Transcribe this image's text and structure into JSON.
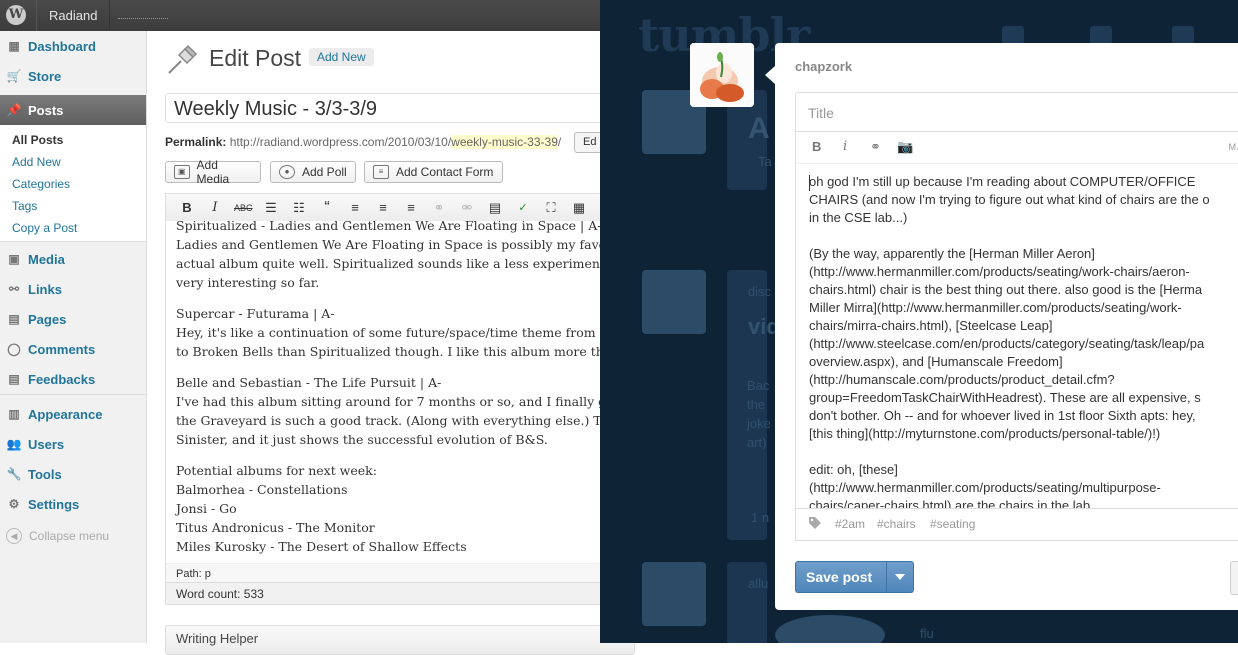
{
  "wp": {
    "site_name": "Radiand",
    "menu": [
      {
        "label": "Dashboard"
      },
      {
        "label": "Store"
      },
      {
        "label": "Posts"
      },
      {
        "label": "Media"
      },
      {
        "label": "Links"
      },
      {
        "label": "Pages"
      },
      {
        "label": "Comments"
      },
      {
        "label": "Feedbacks"
      },
      {
        "label": "Appearance"
      },
      {
        "label": "Users"
      },
      {
        "label": "Tools"
      },
      {
        "label": "Settings"
      }
    ],
    "posts_submenu": [
      "All Posts",
      "Add New",
      "Categories",
      "Tags",
      "Copy a Post"
    ],
    "collapse_label": "Collapse menu",
    "page_title": "Edit Post",
    "add_new_label": "Add New",
    "post_title": "Weekly Music - 3/3-3/9",
    "permalink_label": "Permalink:",
    "permalink_base": "http://radiand.wordpress.com/2010/03/10/",
    "permalink_slug": "weekly-music-33-39",
    "permalink_tail": "/",
    "edit_slug_label": "Ed",
    "media_buttons": [
      "Add Media",
      "Add Poll",
      "Add Contact Form"
    ],
    "editor_lines": [
      "Spiritualized - Ladies and Gentlemen We Are Floating in Space | A-",
      "Ladies and Gentlemen We Are Floating in Space is possibly my favori",
      "actual album quite well. Spiritualized sounds like a less experimental",
      "very interesting so far.",
      "Supercar - Futurama | A-",
      "Hey, it's like a continuation of some future/space/time theme from La",
      "to Broken Bells than Spiritualized though. I like this album more than",
      "Belle and Sebastian - The Life Pursuit | A-",
      "I've had this album sitting around for 7 months or so, and I finally ga",
      "the Graveyard is such a good track. (Along with everything else.) The",
      "Sinister, and it just shows the successful evolution of B&S.",
      "Potential albums for next week:",
      "Balmorhea - Constellations",
      "Jonsi - Go",
      "Titus Andronicus - The Monitor",
      "Miles Kurosky - The Desert of Shallow Effects"
    ],
    "path_text": "Path: p",
    "word_count": "Word count: 533",
    "writing_helper": "Writing Helper"
  },
  "tumblr": {
    "logo": "tumblr",
    "blog_name": "chapzork",
    "title_placeholder": "Title",
    "format_more": "MA",
    "post_lines": [
      "oh god I'm still up because I'm reading about COMPUTER/OFFICE",
      "CHAIRS (and now I'm trying to figure out what kind of chairs are the o",
      "in the CSE lab...)",
      "",
      "(By the way, apparently the [Herman Miller Aeron]",
      "(http://www.hermanmiller.com/products/seating/work-chairs/aeron-",
      "chairs.html) chair is the best thing out there. also good is the [Herma",
      "Miller Mirra](http://www.hermanmiller.com/products/seating/work-",
      "chairs/mirra-chairs.html), [Steelcase Leap]",
      "(http://www.steelcase.com/en/products/category/seating/task/leap/pa",
      "overview.aspx), and [Humanscale Freedom]",
      "(http://humanscale.com/products/product_detail.cfm?",
      "group=FreedomTaskChairWithHeadrest). These are all expensive, s",
      "don't bother. Oh -- and for whoever lived in 1st floor Sixth apts: hey,",
      "[this thing](http://myturnstone.com/products/personal-table/)!)",
      "",
      "edit: oh, [these]",
      "(http://www.hermanmiller.com/products/seating/multipurpose-",
      "chairs/caper-chairs.html) are the chairs in the lab."
    ],
    "tags": [
      "#2am",
      "#chairs",
      "#seating"
    ],
    "save_label": "Save post",
    "background": {
      "heading_fragment": "A",
      "video_fragment": "vid",
      "snippets": [
        "Ta",
        "disc",
        "Bac",
        "the",
        "joke",
        "art)",
        "1 n",
        "allu",
        "flu"
      ]
    }
  }
}
